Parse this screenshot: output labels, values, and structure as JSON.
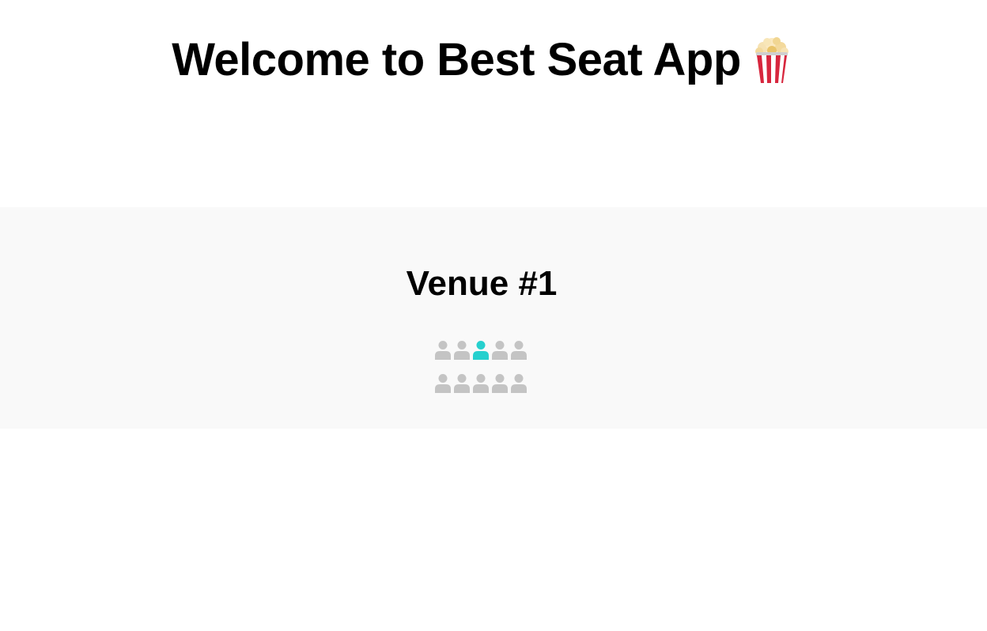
{
  "header": {
    "title": "Welcome to Best Seat App",
    "icon": "popcorn-icon"
  },
  "venue": {
    "title": "Venue #1",
    "colors": {
      "available": "#c4c4c4",
      "selected": "#26d0ce",
      "background": "#f9f9f9"
    },
    "rows": [
      [
        {
          "status": "available"
        },
        {
          "status": "available"
        },
        {
          "status": "selected"
        },
        {
          "status": "available"
        },
        {
          "status": "available"
        }
      ],
      [
        {
          "status": "available"
        },
        {
          "status": "available"
        },
        {
          "status": "available"
        },
        {
          "status": "available"
        },
        {
          "status": "available"
        }
      ]
    ]
  }
}
